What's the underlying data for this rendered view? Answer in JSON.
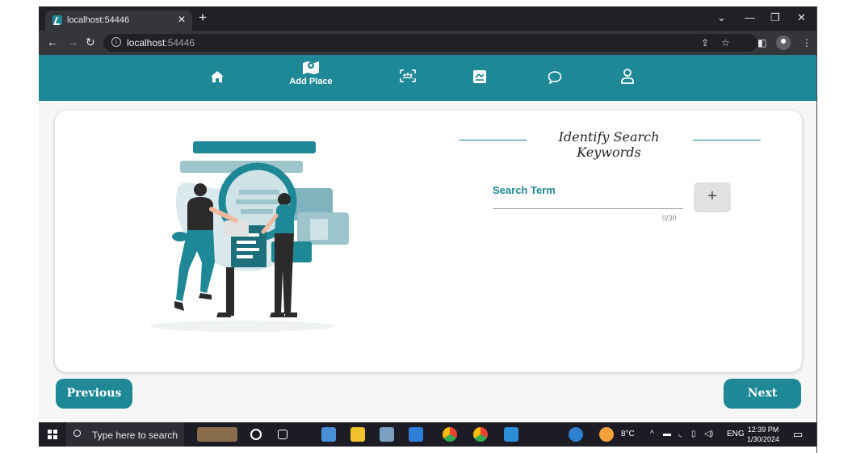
{
  "browser": {
    "tab_title": "localhost:54446",
    "url_host": "localhost",
    "url_port": ":54446"
  },
  "nav": {
    "items": [
      {
        "id": "home",
        "icon": "home-icon",
        "label": ""
      },
      {
        "id": "add-place",
        "icon": "map-pin-icon",
        "label": "Add Place"
      },
      {
        "id": "people",
        "icon": "group-scan-icon",
        "label": ""
      },
      {
        "id": "photos",
        "icon": "image-swap-icon",
        "label": ""
      },
      {
        "id": "chat",
        "icon": "chat-bubble-icon",
        "label": ""
      },
      {
        "id": "profile",
        "icon": "user-icon",
        "label": ""
      }
    ]
  },
  "form": {
    "heading": "Identify Search Keywords",
    "field_label": "Search Term",
    "field_value": "",
    "counter": "0/30",
    "add_label": "+"
  },
  "footer": {
    "previous_label": "Previous",
    "next_label": "Next"
  },
  "taskbar": {
    "search_placeholder": "Type here to search",
    "weather": "8°C",
    "language": "ENG",
    "time": "12:39 PM",
    "date": "1/30/2024"
  },
  "colors": {
    "accent": "#1e8897",
    "card": "#ffffff",
    "page_bg": "#f6f6f6"
  }
}
